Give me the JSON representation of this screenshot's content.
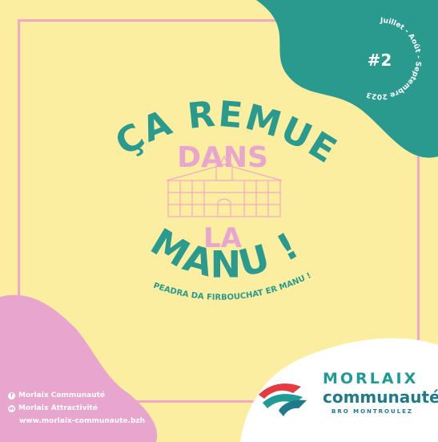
{
  "title": {
    "line1": "ÇA REMUE",
    "word_dans": "DANS",
    "word_la": "LA",
    "line3": "MANU !"
  },
  "subtitle": "PEADRA DA FIRBOUCHAT ER MANU !",
  "issue": {
    "number": "#2",
    "period": "Juillet - Août - Septembre 2023"
  },
  "social": {
    "facebook": "Morlaix Communauté",
    "linkedin": "Morlaix Attractivité",
    "website": "www.morlaix-communaute.bzh"
  },
  "logo": {
    "line1": "MORLAIX",
    "line2": "communauté",
    "line3": "BRO MONTROULEZ"
  },
  "colors": {
    "background": "#fbeea0",
    "teal": "#2a9a8f",
    "pink": "#e8a6cf",
    "frame_pink": "#f2a9c8"
  },
  "icons": [
    "facebook-icon",
    "linkedin-icon",
    "logo-mark-icon",
    "building-drawing-icon"
  ]
}
